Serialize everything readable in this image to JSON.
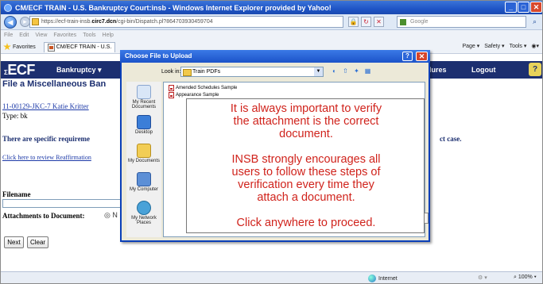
{
  "window": {
    "title": "CM/ECF TRAIN - U.S. Bankruptcy Court:insb - Windows Internet Explorer provided by Yahoo!",
    "url_prefix": "https://ecf-train-insb.",
    "url_domain": "circ7.dcn",
    "url_path": "/cgi-bin/Dispatch.pl?864703930459704",
    "search_placeholder": "Google"
  },
  "menu": [
    "File",
    "Edit",
    "View",
    "Favorites",
    "Tools",
    "Help"
  ],
  "favorites": {
    "favorites_label": "Favorites",
    "tab_label": "CM/ECF TRAIN - U.S.",
    "commands": [
      "Page ▾",
      "Safety ▾",
      "Tools ▾"
    ]
  },
  "ecf": {
    "logo": "ECF",
    "menu_bankruptcy": "Bankruptcy ▾",
    "menu_procedures": "dures",
    "menu_logout": "Logout",
    "help_symbol": "?"
  },
  "page": {
    "title": "File a Miscellaneous Ban",
    "case_link": "11-00129-JKC-7 Katie Kritter",
    "type_line": "Type: bk",
    "requirements": "There are specific requireme",
    "requirements_tail": "ct case.",
    "reaffirm_link": "Click here to review Reaffirmation ",
    "filename_label": "Filename",
    "attachments_label": "Attachments to Document:",
    "attachments_radio": "◎ N",
    "next_button": "Next",
    "clear_button": "Clear"
  },
  "dialog": {
    "title": "Choose File to Upload",
    "help": "?",
    "close": "✕",
    "lookin_label": "Look in:",
    "lookin_value": "Train PDFs",
    "places": [
      {
        "label": "My Recent\nDocuments",
        "icon": "recent-documents-icon"
      },
      {
        "label": "Desktop",
        "icon": "desktop-icon"
      },
      {
        "label": "My Documents",
        "icon": "my-documents-icon"
      },
      {
        "label": "My Computer",
        "icon": "my-computer-icon"
      },
      {
        "label": "My Network\nPlaces",
        "icon": "network-places-icon"
      }
    ],
    "files": [
      "Amended Schedules Sample",
      "Appearance Sample"
    ]
  },
  "overlay": {
    "line1": "It is always important to verify",
    "line2": "the attachment is the correct",
    "line3": "document.",
    "line4": "INSB strongly encourages all",
    "line5": "users to follow these steps of",
    "line6": "verification every time they",
    "line7": "attach a document.",
    "line8": "Click anywhere to proceed.",
    "text_color": "#d0231c"
  },
  "status": {
    "zone": "Internet",
    "zoom": "100%"
  },
  "colors": {
    "ecf_bar": "#1c2f70",
    "titlebar": "#1f55c6",
    "link": "#1d3aa8"
  }
}
